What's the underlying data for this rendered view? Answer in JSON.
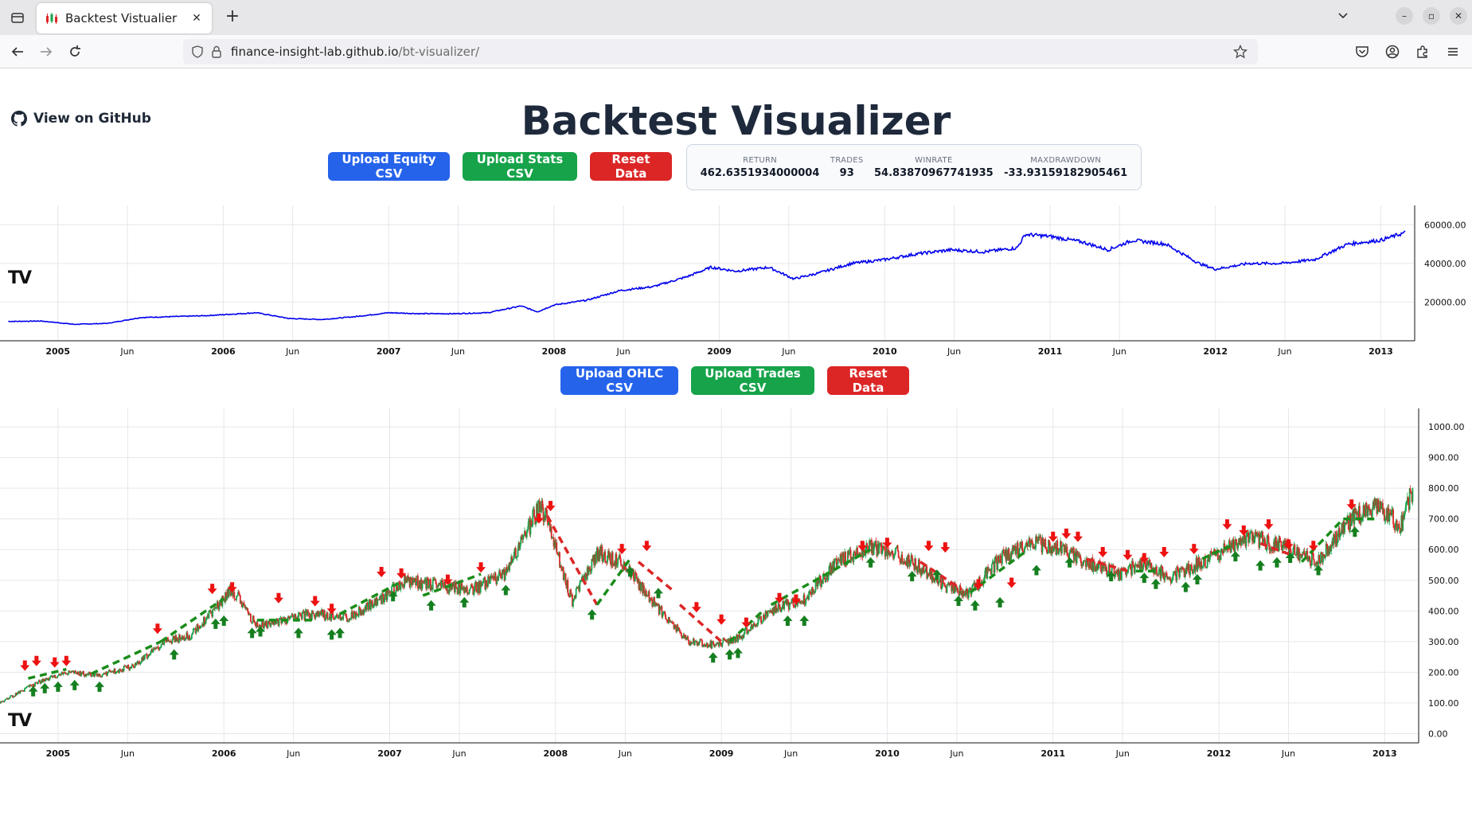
{
  "browser": {
    "tab_title": "Backtest Vistualier",
    "url_host": "finance-insight-lab.github.io",
    "url_path": "/bt-visualizer/"
  },
  "page": {
    "github_link": "View on GitHub",
    "title": "Backtest Visualizer",
    "upload_equity": "Upload Equity CSV",
    "upload_stats": "Upload Stats CSV",
    "reset_1": "Reset Data",
    "upload_ohlc": "Upload OHLC CSV",
    "upload_trades": "Upload Trades CSV",
    "reset_2": "Reset Data"
  },
  "stats": [
    {
      "label": "RETURN",
      "value": "462.6351934000004"
    },
    {
      "label": "TRADES",
      "value": "93"
    },
    {
      "label": "WINRATE",
      "value": "54.83870967741935"
    },
    {
      "label": "MAXDRAWDOWN",
      "value": "-33.93159182905461"
    }
  ],
  "colors": {
    "equity_line": "#0000ee",
    "up_candle": "#16a34a",
    "down_candle": "#dc2626",
    "trade_line": "#1a8c1a",
    "grid": "#e5e7eb"
  },
  "chart_data": [
    {
      "type": "line",
      "title": "",
      "x_ticks": [
        "2005",
        "Jun",
        "2006",
        "Jun",
        "2007",
        "Jun",
        "2008",
        "Jun",
        "2009",
        "Jun",
        "2010",
        "Jun",
        "2011",
        "Jun",
        "2012",
        "Jun",
        "2013"
      ],
      "y_ticks": [
        "60000.00",
        "40000.00",
        "20000.00"
      ],
      "ylim": [
        0,
        70000
      ],
      "series": [
        {
          "x": [
            2004.7,
            2004.9,
            2005.1,
            2005.3,
            2005.5,
            2005.7,
            2005.9,
            2006.0,
            2006.2,
            2006.4,
            2006.6,
            2006.8,
            2007.0,
            2007.2,
            2007.4,
            2007.6,
            2007.8,
            2007.9,
            2008.0,
            2008.2,
            2008.4,
            2008.6,
            2008.8,
            2008.95,
            2009.1,
            2009.3,
            2009.45,
            2009.6,
            2009.8,
            2010.0,
            2010.2,
            2010.4,
            2010.6,
            2010.8,
            2010.85,
            2011.0,
            2011.2,
            2011.35,
            2011.5,
            2011.7,
            2011.9,
            2012.0,
            2012.2,
            2012.4,
            2012.6,
            2012.8,
            2013.0,
            2013.15
          ],
          "y": [
            10000,
            10200,
            8500,
            9000,
            12000,
            12500,
            13000,
            13500,
            14500,
            11500,
            11000,
            12500,
            14500,
            14000,
            14000,
            14500,
            18000,
            15000,
            18500,
            21000,
            26000,
            28000,
            33000,
            38000,
            36000,
            38000,
            32000,
            35000,
            40000,
            42000,
            45000,
            47000,
            46000,
            48000,
            55000,
            54000,
            51000,
            47000,
            52000,
            50000,
            40000,
            37000,
            40000,
            40000,
            42000,
            50000,
            52000,
            56000
          ]
        }
      ]
    },
    {
      "type": "candlestick",
      "title": "",
      "x_ticks": [
        "2005",
        "Jun",
        "2006",
        "Jun",
        "2007",
        "Jun",
        "2008",
        "Jun",
        "2009",
        "Jun",
        "2010",
        "Jun",
        "2011",
        "Jun",
        "2012",
        "Jun",
        "2013"
      ],
      "y_ticks": [
        "1000.00",
        "900.00",
        "800.00",
        "700.00",
        "600.00",
        "500.00",
        "400.00",
        "300.00",
        "200.00",
        "100.00",
        "0.00"
      ],
      "ylim": [
        -30,
        1060
      ],
      "price_path": {
        "x": [
          2004.65,
          2004.85,
          2005.05,
          2005.25,
          2005.45,
          2005.65,
          2005.8,
          2005.95,
          2006.05,
          2006.2,
          2006.35,
          2006.55,
          2006.75,
          2006.95,
          2007.1,
          2007.3,
          2007.5,
          2007.7,
          2007.9,
          2007.95,
          2008.1,
          2008.25,
          2008.4,
          2008.6,
          2008.8,
          2008.95,
          2009.1,
          2009.3,
          2009.5,
          2009.7,
          2009.9,
          2010.05,
          2010.2,
          2010.35,
          2010.5,
          2010.7,
          2010.9,
          2011.05,
          2011.2,
          2011.4,
          2011.55,
          2011.7,
          2011.9,
          2012.05,
          2012.2,
          2012.4,
          2012.6,
          2012.8,
          2012.95,
          2013.1,
          2013.17
        ],
        "y": [
          100,
          160,
          200,
          190,
          220,
          300,
          320,
          410,
          470,
          350,
          370,
          390,
          380,
          440,
          500,
          480,
          470,
          520,
          740,
          700,
          430,
          590,
          560,
          420,
          300,
          290,
          310,
          400,
          440,
          560,
          610,
          590,
          540,
          480,
          460,
          580,
          620,
          600,
          560,
          520,
          560,
          510,
          560,
          600,
          640,
          610,
          560,
          700,
          740,
          680,
          800
        ]
      },
      "trade_lines": [
        {
          "x": [
            2004.82,
            2005.05
          ],
          "y": [
            180,
            210
          ]
        },
        {
          "x": [
            2005.2,
            2005.62
          ],
          "y": [
            195,
            300
          ]
        },
        {
          "x": [
            2005.62,
            2006.0
          ],
          "y": [
            300,
            440
          ]
        },
        {
          "x": [
            2006.2,
            2006.55
          ],
          "y": [
            370,
            370
          ]
        },
        {
          "x": [
            2006.7,
            2007.05
          ],
          "y": [
            390,
            490
          ]
        },
        {
          "x": [
            2007.2,
            2007.55
          ],
          "y": [
            450,
            520
          ]
        },
        {
          "x": [
            2007.95,
            2008.25
          ],
          "y": [
            710,
            420
          ]
        },
        {
          "x": [
            2008.25,
            2008.45
          ],
          "y": [
            420,
            570
          ]
        },
        {
          "x": [
            2008.5,
            2008.7
          ],
          "y": [
            560,
            470
          ]
        },
        {
          "x": [
            2008.75,
            2009.0
          ],
          "y": [
            420,
            300
          ]
        },
        {
          "x": [
            2009.05,
            2009.25
          ],
          "y": [
            300,
            400
          ]
        },
        {
          "x": [
            2009.3,
            2009.9
          ],
          "y": [
            420,
            600
          ]
        },
        {
          "x": [
            2010.2,
            2010.45
          ],
          "y": [
            560,
            470
          ]
        },
        {
          "x": [
            2010.5,
            2010.85
          ],
          "y": [
            460,
            600
          ]
        },
        {
          "x": [
            2011.2,
            2011.45
          ],
          "y": [
            570,
            530
          ]
        },
        {
          "x": [
            2011.5,
            2011.65
          ],
          "y": [
            530,
            530
          ]
        },
        {
          "x": [
            2011.9,
            2012.1
          ],
          "y": [
            570,
            620
          ]
        },
        {
          "x": [
            2012.25,
            2012.45
          ],
          "y": [
            620,
            580
          ]
        },
        {
          "x": [
            2012.5,
            2012.75
          ],
          "y": [
            560,
            700
          ]
        },
        {
          "x": [
            2012.75,
            2012.95
          ],
          "y": [
            700,
            700
          ]
        }
      ],
      "buy_markers": [
        {
          "x": 2004.85,
          "y": 150
        },
        {
          "x": 2004.92,
          "y": 160
        },
        {
          "x": 2005.0,
          "y": 165
        },
        {
          "x": 2005.1,
          "y": 170
        },
        {
          "x": 2005.25,
          "y": 165
        },
        {
          "x": 2005.7,
          "y": 270
        },
        {
          "x": 2005.95,
          "y": 370
        },
        {
          "x": 2006.0,
          "y": 380
        },
        {
          "x": 2006.17,
          "y": 340
        },
        {
          "x": 2006.22,
          "y": 345
        },
        {
          "x": 2006.45,
          "y": 340
        },
        {
          "x": 2006.65,
          "y": 335
        },
        {
          "x": 2006.7,
          "y": 340
        },
        {
          "x": 2007.02,
          "y": 460
        },
        {
          "x": 2007.25,
          "y": 430
        },
        {
          "x": 2007.45,
          "y": 440
        },
        {
          "x": 2007.7,
          "y": 480
        },
        {
          "x": 2008.22,
          "y": 400
        },
        {
          "x": 2008.45,
          "y": 540
        },
        {
          "x": 2008.62,
          "y": 470
        },
        {
          "x": 2008.95,
          "y": 260
        },
        {
          "x": 2009.05,
          "y": 270
        },
        {
          "x": 2009.1,
          "y": 275
        },
        {
          "x": 2009.4,
          "y": 380
        },
        {
          "x": 2009.5,
          "y": 380
        },
        {
          "x": 2009.9,
          "y": 570
        },
        {
          "x": 2010.15,
          "y": 525
        },
        {
          "x": 2010.3,
          "y": 530
        },
        {
          "x": 2010.43,
          "y": 445
        },
        {
          "x": 2010.53,
          "y": 430
        },
        {
          "x": 2010.68,
          "y": 440
        },
        {
          "x": 2010.9,
          "y": 545
        },
        {
          "x": 2011.1,
          "y": 570
        },
        {
          "x": 2011.35,
          "y": 525
        },
        {
          "x": 2011.55,
          "y": 520
        },
        {
          "x": 2011.62,
          "y": 500
        },
        {
          "x": 2011.8,
          "y": 490
        },
        {
          "x": 2011.87,
          "y": 515
        },
        {
          "x": 2012.1,
          "y": 590
        },
        {
          "x": 2012.25,
          "y": 560
        },
        {
          "x": 2012.35,
          "y": 570
        },
        {
          "x": 2012.43,
          "y": 585
        },
        {
          "x": 2012.6,
          "y": 545
        },
        {
          "x": 2012.82,
          "y": 670
        }
      ],
      "sell_markers": [
        {
          "x": 2004.8,
          "y": 210
        },
        {
          "x": 2004.87,
          "y": 225
        },
        {
          "x": 2004.98,
          "y": 220
        },
        {
          "x": 2005.05,
          "y": 225
        },
        {
          "x": 2005.6,
          "y": 330
        },
        {
          "x": 2005.93,
          "y": 460
        },
        {
          "x": 2006.05,
          "y": 465
        },
        {
          "x": 2006.33,
          "y": 430
        },
        {
          "x": 2006.55,
          "y": 420
        },
        {
          "x": 2006.65,
          "y": 395
        },
        {
          "x": 2006.95,
          "y": 515
        },
        {
          "x": 2007.07,
          "y": 510
        },
        {
          "x": 2007.35,
          "y": 490
        },
        {
          "x": 2007.55,
          "y": 530
        },
        {
          "x": 2007.9,
          "y": 690
        },
        {
          "x": 2007.97,
          "y": 730
        },
        {
          "x": 2008.4,
          "y": 590
        },
        {
          "x": 2008.55,
          "y": 600
        },
        {
          "x": 2008.85,
          "y": 400
        },
        {
          "x": 2009.0,
          "y": 360
        },
        {
          "x": 2009.15,
          "y": 350
        },
        {
          "x": 2009.35,
          "y": 430
        },
        {
          "x": 2009.45,
          "y": 425
        },
        {
          "x": 2009.85,
          "y": 600
        },
        {
          "x": 2010.0,
          "y": 610
        },
        {
          "x": 2010.25,
          "y": 600
        },
        {
          "x": 2010.35,
          "y": 595
        },
        {
          "x": 2010.55,
          "y": 475
        },
        {
          "x": 2010.75,
          "y": 480
        },
        {
          "x": 2011.0,
          "y": 630
        },
        {
          "x": 2011.08,
          "y": 640
        },
        {
          "x": 2011.15,
          "y": 630
        },
        {
          "x": 2011.3,
          "y": 580
        },
        {
          "x": 2011.45,
          "y": 570
        },
        {
          "x": 2011.55,
          "y": 560
        },
        {
          "x": 2011.67,
          "y": 580
        },
        {
          "x": 2011.85,
          "y": 590
        },
        {
          "x": 2012.05,
          "y": 670
        },
        {
          "x": 2012.15,
          "y": 650
        },
        {
          "x": 2012.3,
          "y": 670
        },
        {
          "x": 2012.42,
          "y": 605
        },
        {
          "x": 2012.57,
          "y": 600
        },
        {
          "x": 2012.8,
          "y": 735
        }
      ]
    }
  ]
}
